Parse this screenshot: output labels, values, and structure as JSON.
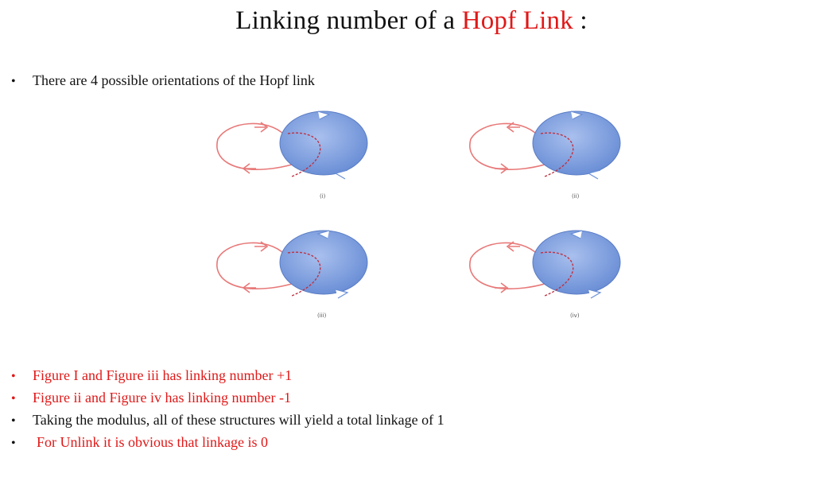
{
  "title": {
    "prefix": "Linking number of  a ",
    "highlight": "Hopf  Link",
    "suffix": " :"
  },
  "intro_bullet": "There are 4 possible orientations of the Hopf link",
  "figures": [
    {
      "label": "(i)"
    },
    {
      "label": "(ii)"
    },
    {
      "label": "(iii)"
    },
    {
      "label": "(iv)"
    }
  ],
  "bullets": [
    {
      "text": "Figure I and Figure iii has linking number +1",
      "color": "#e01818"
    },
    {
      "text": "Figure ii and Figure iv has linking number -1",
      "color": "#e01818"
    },
    {
      "text": "Taking the modulus, all of these structures will yield a total linkage of 1",
      "color": "#111111"
    },
    {
      "text": "For Unlink it is obvious that linkage is 0",
      "color": "#e01818"
    }
  ],
  "colors": {
    "accent_red": "#e01818",
    "circle_blue": "#7b9ee0"
  }
}
